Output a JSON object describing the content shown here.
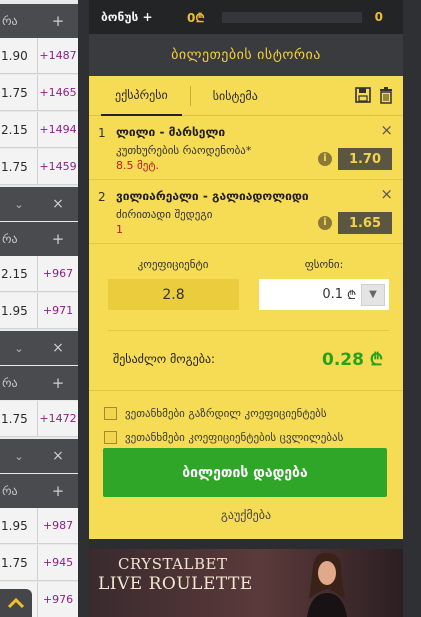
{
  "left_rows": [
    {
      "type": "head",
      "label": "რა",
      "icon": "plus-icon",
      "glyph": "+"
    },
    {
      "type": "data",
      "odd": "1.90",
      "count": "+1487"
    },
    {
      "type": "data",
      "odd": "1.75",
      "count": "+1465"
    },
    {
      "type": "data",
      "odd": "2.15",
      "count": "+1494"
    },
    {
      "type": "data",
      "odd": "1.75",
      "count": "+1459"
    },
    {
      "type": "collapse"
    },
    {
      "type": "head",
      "label": "რა",
      "icon": "plus-icon",
      "glyph": "+"
    },
    {
      "type": "data",
      "odd": "2.15",
      "count": "+967"
    },
    {
      "type": "data",
      "odd": "1.95",
      "count": "+971"
    },
    {
      "type": "collapse"
    },
    {
      "type": "head",
      "label": "რა",
      "icon": "plus-icon",
      "glyph": "+"
    },
    {
      "type": "data",
      "odd": "1.75",
      "count": "+1472"
    },
    {
      "type": "collapse"
    },
    {
      "type": "head",
      "label": "რა",
      "icon": "plus-icon",
      "glyph": "+"
    },
    {
      "type": "data",
      "odd": "1.95",
      "count": "+987"
    },
    {
      "type": "data",
      "odd": "1.75",
      "count": "+945"
    },
    {
      "type": "data",
      "odd": "",
      "count": "+976"
    }
  ],
  "topbar": {
    "bonus_label": "ბონუს +",
    "bonus_value": "0",
    "counter": "0"
  },
  "history_title": "ბილეთების ისტორია",
  "tabs": {
    "express": "ექსპრესი",
    "system": "სისტემა"
  },
  "selections": [
    {
      "num": "1",
      "title": "ლილი - მარსელი",
      "market": "კუთხურების რაოდენობა*",
      "pick": "8.5 მეტ.",
      "odd": "1.70"
    },
    {
      "num": "2",
      "title": "ვილიარეალი - გალიადოლიდი",
      "market": "ძირითადი შედეგი",
      "pick": "1",
      "odd": "1.65"
    }
  ],
  "calc": {
    "coef_label": "კოეფიციენტი",
    "coef_value": "2.8",
    "stake_label": "ფსონი:",
    "stake_value": "0.1",
    "currency": "₾",
    "win_label": "შესაძლო მოგება:",
    "win_value": "0.28 ₾"
  },
  "checks": {
    "accept_increased": "ვეთანხმები გაზრდილ კოეფიციენტებს",
    "accept_changes": "ვეთანხმები კოეფიციენტების ცვლილებას"
  },
  "buttons": {
    "place_bet": "ბილეთის დადება",
    "clear": "გაუქმება"
  },
  "banner": {
    "line1": "CRYSTALBET",
    "line2": "LIVE ROULETTE"
  },
  "colors": {
    "slip_bg": "#f6dc55",
    "accent_green": "#2fa628",
    "accent_gold": "#f0c02a",
    "count_purple": "#8e1e8a"
  }
}
